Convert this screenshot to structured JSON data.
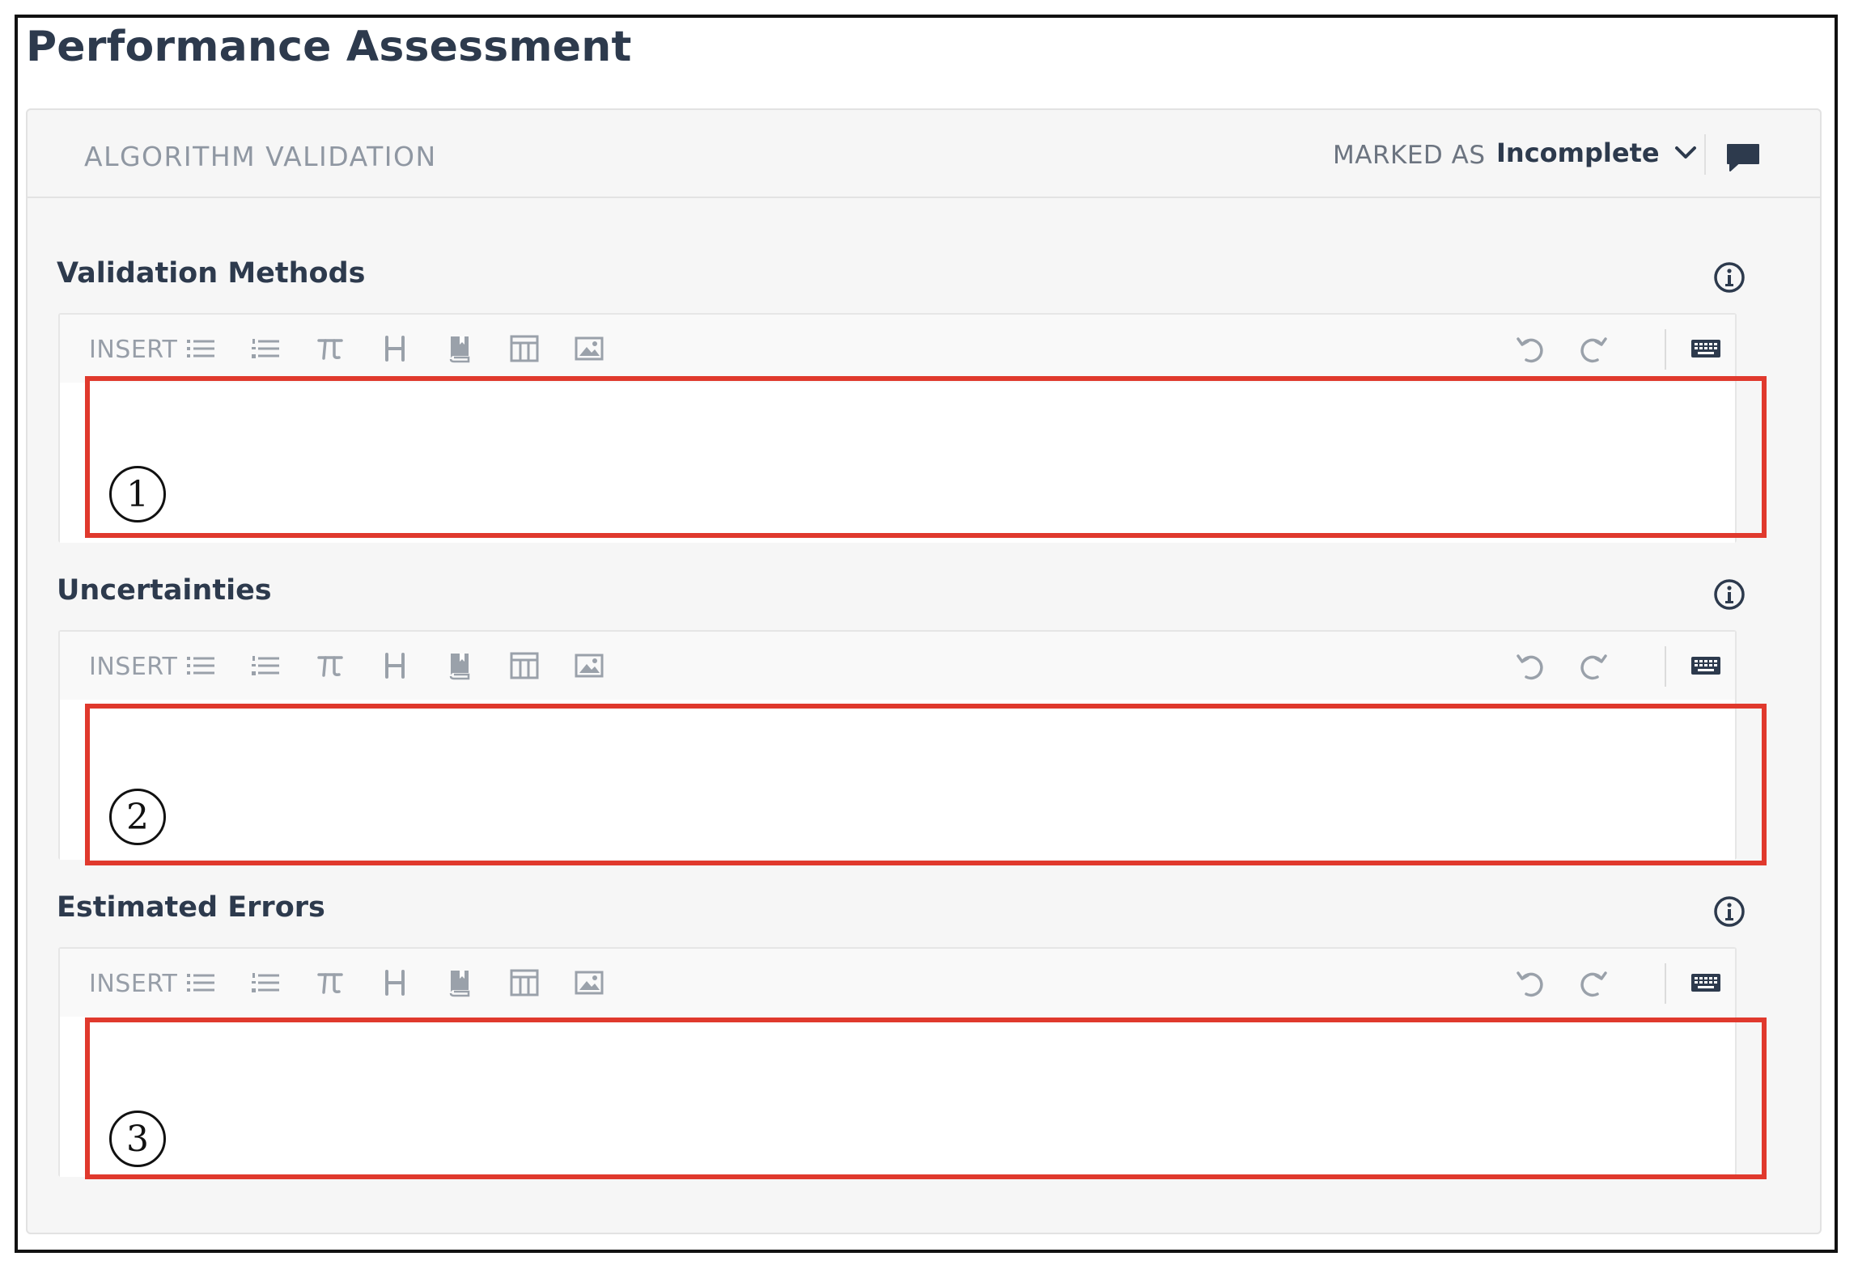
{
  "page": {
    "title": "Performance Assessment"
  },
  "section": {
    "title": "ALGORITHM VALIDATION",
    "marked_as_label": "MARKED AS",
    "status": "Incomplete",
    "icons": {
      "status_dropdown": "chevron-down-icon",
      "comments": "comment-icon"
    }
  },
  "toolbar": {
    "insert_label": "INSERT",
    "buttons": [
      "bulleted-list",
      "numbered-list",
      "math-pi",
      "heading",
      "citation-bookmark",
      "table",
      "image"
    ],
    "right_buttons": [
      "undo",
      "redo",
      "keyboard"
    ]
  },
  "fields": [
    {
      "label": "Validation Methods",
      "value": "",
      "marker": "1",
      "info_icon": "info-icon"
    },
    {
      "label": "Uncertainties",
      "value": "",
      "marker": "2",
      "info_icon": "info-icon"
    },
    {
      "label": "Estimated Errors",
      "value": "",
      "marker": "3",
      "info_icon": "info-icon"
    }
  ],
  "colors": {
    "title": "#2d3a4d",
    "muted": "#8f97a2",
    "card_bg": "#f6f6f6",
    "highlight": "#e0392d",
    "icon": "#9aa1aa",
    "icon_dark": "#2d3a4d"
  }
}
